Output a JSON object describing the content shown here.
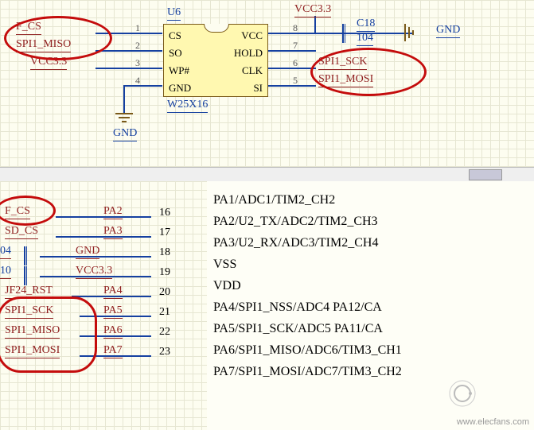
{
  "schematic": {
    "component_ref": "U6",
    "component_part": "W25X16",
    "pins": {
      "1": {
        "num": "1",
        "name": "CS"
      },
      "2": {
        "num": "2",
        "name": "SO"
      },
      "3": {
        "num": "3",
        "name": "WP#"
      },
      "4": {
        "num": "4",
        "name": "GND"
      },
      "5": {
        "num": "5",
        "name": "SI"
      },
      "6": {
        "num": "6",
        "name": "CLK"
      },
      "7": {
        "num": "7",
        "name": "HOLD"
      },
      "8": {
        "num": "8",
        "name": "VCC"
      }
    },
    "nets": {
      "left": [
        "F_CS",
        "SPI1_MISO",
        "VCC3.3",
        ""
      ],
      "right_top": "VCC3.3",
      "right": [
        "",
        "",
        "SPI1_SCK",
        "SPI1_MOSI"
      ],
      "gnd_bottom": "GND",
      "gnd_right": "GND",
      "cap_ref": "C18",
      "cap_val": "104"
    }
  },
  "pin_table": {
    "rows": [
      {
        "net": "F_CS",
        "port": "PA2",
        "pin": "16"
      },
      {
        "net": "SD_CS",
        "port": "PA3",
        "pin": "17"
      },
      {
        "net": "04",
        "port": "GND",
        "pin": "18"
      },
      {
        "net": "10",
        "port": "VCC3.3",
        "pin": "19"
      },
      {
        "net": "JF24_RST",
        "port": "PA4",
        "pin": "20"
      },
      {
        "net": "SPI1_SCK",
        "port": "PA5",
        "pin": "21"
      },
      {
        "net": "SPI1_MISO",
        "port": "PA6",
        "pin": "22"
      },
      {
        "net": "SPI1_MOSI",
        "port": "PA7",
        "pin": "23"
      }
    ]
  },
  "mcu_pin_functions": [
    "PA1/ADC1/TIM2_CH2",
    "PA2/U2_TX/ADC2/TIM2_CH3",
    "PA3/U2_RX/ADC3/TIM2_CH4",
    "VSS",
    "VDD",
    "PA4/SPI1_NSS/ADC4        PA12/CA",
    "PA5/SPI1_SCK/ADC5        PA11/CA",
    "PA6/SPI1_MISO/ADC6/TIM3_CH1",
    "PA7/SPI1_MOSI/ADC7/TIM3_CH2"
  ],
  "watermark": "www.elecfans.com"
}
